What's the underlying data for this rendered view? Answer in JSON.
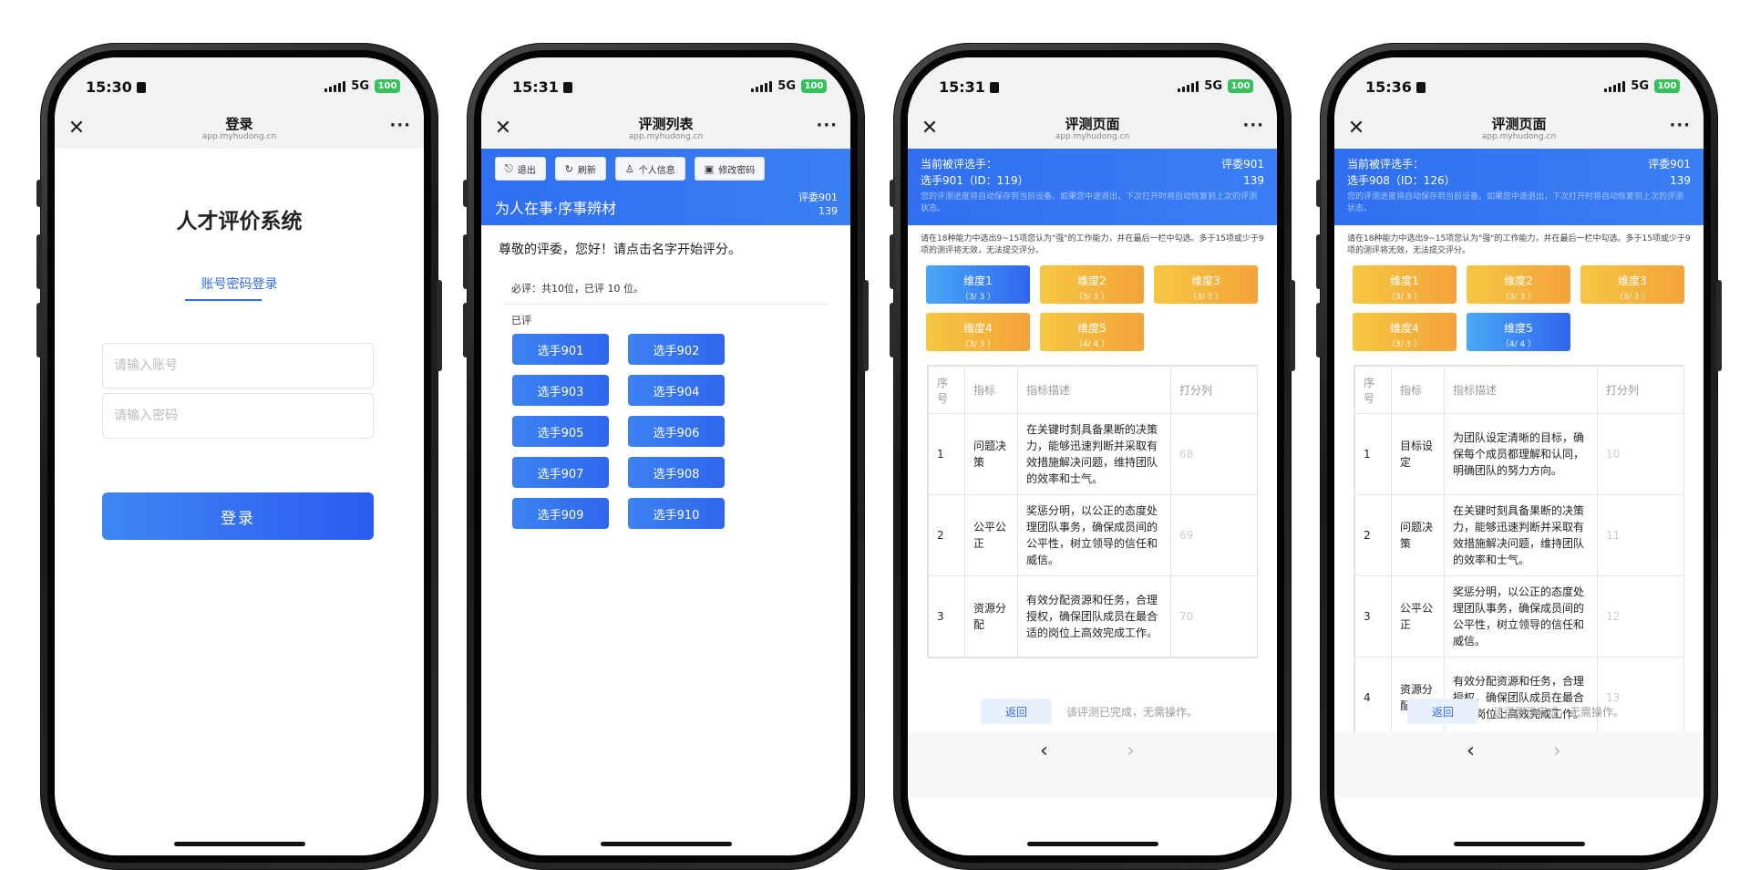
{
  "status": {
    "network": "5G",
    "battery": "100"
  },
  "screen1": {
    "time": "15:30",
    "nav_title": "登录",
    "domain": "app.myhudong.cn",
    "title": "人才评价系统",
    "tab_label": "账号密码登录",
    "account_placeholder": "请输入账号",
    "password_placeholder": "请输入密码",
    "login_label": "登录"
  },
  "screen2": {
    "time": "15:31",
    "nav_title": "评测列表",
    "domain": "app.myhudong.cn",
    "toolbar": {
      "logout": "退出",
      "refresh": "刷新",
      "profile": "个人信息",
      "change_password": "修改密码"
    },
    "banner_title": "为人在事·序事辨材",
    "judge_name": "评委901",
    "judge_id": "139",
    "greeting": "尊敬的评委，您好！请点击名字开始评分。",
    "required": "必评：共10位，已评 10 位。",
    "done_label": "已评",
    "players": [
      "选手901",
      "选手902",
      "选手903",
      "选手904",
      "选手905",
      "选手906",
      "选手907",
      "选手908",
      "选手909",
      "选手910"
    ]
  },
  "screen3": {
    "time": "15:31",
    "nav_title": "评测页面",
    "domain": "app.myhudong.cn",
    "current_label": "当前被评选手：",
    "current_player": "选手901（ID：119）",
    "judge_name": "评委901",
    "judge_id": "139",
    "note": "您的评测进度将自动保存到当前设备。如果您中途退出，下次打开时将自动恢复到上次的评测状态。",
    "instruction": "请在18种能力中选出9~15项您认为\"强\"的工作能力，并在最后一栏中勾选。多于15项或少于9项的测评将无效，无法提交评分。",
    "dimensions": [
      {
        "name": "维度1",
        "count": "（3/ 3 ）",
        "color": "blue"
      },
      {
        "name": "维度2",
        "count": "（3/ 3 ）",
        "color": "orange"
      },
      {
        "name": "维度3",
        "count": "（3/ 3 ）",
        "color": "orange"
      },
      {
        "name": "维度4",
        "count": "（3/ 3 ）",
        "color": "orange"
      },
      {
        "name": "维度5",
        "count": "（4/ 4 ）",
        "color": "orange"
      }
    ],
    "table_headers": [
      "序号",
      "指标",
      "指标描述",
      "打分列"
    ],
    "rows": [
      {
        "no": "1",
        "metric": "问题决策",
        "desc": "在关键时刻具备果断的决策力，能够迅速判断并采取有效措施解决问题，维持团队的效率和士气。",
        "score": "68"
      },
      {
        "no": "2",
        "metric": "公平公正",
        "desc": "奖惩分明，以公正的态度处理团队事务，确保成员间的公平性，树立领导的信任和威信。",
        "score": "69"
      },
      {
        "no": "3",
        "metric": "资源分配",
        "desc": "有效分配资源和任务，合理授权，确保团队成员在最合适的岗位上高效完成工作。",
        "score": "70"
      }
    ],
    "back_label": "返回",
    "done_msg": "该评测已完成，无需操作。"
  },
  "screen4": {
    "time": "15:36",
    "nav_title": "评测页面",
    "domain": "app.myhudong.cn",
    "current_label": "当前被评选手：",
    "current_player": "选手908（ID：126）",
    "judge_name": "评委901",
    "judge_id": "139",
    "note": "您的评测进度将自动保存到当前设备。如果您中途退出，下次打开时将自动恢复到上次的评测状态。",
    "instruction": "请在18种能力中选出9~15项您认为\"强\"的工作能力，并在最后一栏中勾选。多于15项或少于9项的测评将无效，无法提交评分。",
    "dimensions": [
      {
        "name": "维度1",
        "count": "（3/ 3 ）",
        "color": "orange"
      },
      {
        "name": "维度2",
        "count": "（3/ 3 ）",
        "color": "orange"
      },
      {
        "name": "维度3",
        "count": "（3/ 3 ）",
        "color": "orange"
      },
      {
        "name": "维度4",
        "count": "（3/ 3 ）",
        "color": "orange"
      },
      {
        "name": "维度5",
        "count": "（4/ 4 ）",
        "color": "blue"
      }
    ],
    "table_headers": [
      "序号",
      "指标",
      "指标描述",
      "打分列"
    ],
    "rows": [
      {
        "no": "1",
        "metric": "目标设定",
        "desc": "为团队设定清晰的目标，确保每个成员都理解和认同，明确团队的努力方向。",
        "score": "10"
      },
      {
        "no": "2",
        "metric": "问题决策",
        "desc": "在关键时刻具备果断的决策力，能够迅速判断并采取有效措施解决问题，维持团队的效率和士气。",
        "score": "11"
      },
      {
        "no": "3",
        "metric": "公平公正",
        "desc": "奖惩分明，以公正的态度处理团队事务，确保成员间的公平性，树立领导的信任和威信。",
        "score": "12"
      },
      {
        "no": "4",
        "metric": "资源分配",
        "desc": "有效分配资源和任务，合理授权，确保团队成员在最合适的岗位上高效完成工作。",
        "score": "13"
      }
    ],
    "back_label": "返回",
    "done_msg": "该评测已完成，无需操作。"
  },
  "icons": {
    "close": "close-icon",
    "more": "more-icon",
    "logout": "logout-icon",
    "refresh": "refresh-icon",
    "user": "user-icon",
    "lock": "lock-icon",
    "prev": "chevron-left-icon",
    "next": "chevron-right-icon"
  },
  "colors": {
    "primary": "#2f6bef",
    "orange": "#f3a23a",
    "battery": "#36c25a"
  }
}
